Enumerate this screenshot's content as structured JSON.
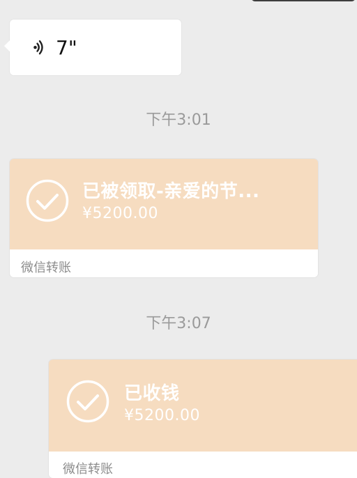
{
  "messages": [
    {
      "type": "voice",
      "duration": "7\"",
      "icon": "voice-wave-icon"
    },
    {
      "type": "timestamp",
      "text": "下午3:01"
    },
    {
      "type": "transfer",
      "status_title": "已被领取-亲爱的节...",
      "amount": "¥5200.00",
      "footer_label": "微信转账",
      "icon": "checkmark-circle-icon",
      "colors": {
        "card": "#f6dcc0",
        "footer": "#ffffff"
      }
    },
    {
      "type": "timestamp",
      "text": "下午3:07"
    },
    {
      "type": "transfer",
      "status_title": "已收钱",
      "amount": "¥5200.00",
      "footer_label": "微信转账",
      "icon": "checkmark-circle-icon",
      "colors": {
        "card": "#f6dcc0",
        "footer": "#ffffff"
      }
    }
  ],
  "colors": {
    "background": "#ececec",
    "bubble": "#ffffff",
    "timestamp_text": "#9a9a9a"
  }
}
